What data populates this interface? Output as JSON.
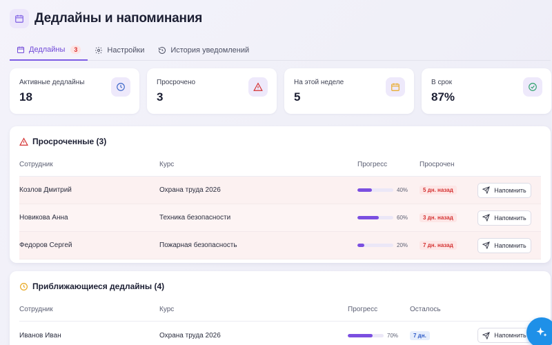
{
  "page": {
    "title": "Дедлайны и напоминания"
  },
  "tabs": [
    {
      "label": "Дедлайны",
      "badge": "3",
      "active": true
    },
    {
      "label": "Настройки",
      "active": false
    },
    {
      "label": "История уведомлений",
      "active": false
    }
  ],
  "stats": [
    {
      "label": "Активные дедлайны",
      "value": "18",
      "icon": "clock-icon"
    },
    {
      "label": "Просрочено",
      "value": "3",
      "icon": "warning-icon"
    },
    {
      "label": "На этой неделе",
      "value": "5",
      "icon": "calendar-icon"
    },
    {
      "label": "В срок",
      "value": "87%",
      "icon": "check-circle-icon"
    }
  ],
  "overdue": {
    "title": "Просроченные (3)",
    "headers": {
      "employee": "Сотрудник",
      "course": "Курс",
      "progress": "Прогресс",
      "status": "Просрочен"
    },
    "rows": [
      {
        "employee": "Козлов Дмитрий",
        "course": "Охрана труда 2026",
        "progress": 40,
        "progress_label": "40%",
        "status": "5 дн. назад",
        "action": "Напомнить"
      },
      {
        "employee": "Новикова Анна",
        "course": "Техника безопасности",
        "progress": 60,
        "progress_label": "60%",
        "status": "3 дн. назад",
        "action": "Напомнить"
      },
      {
        "employee": "Федоров Сергей",
        "course": "Пожарная безопасность",
        "progress": 20,
        "progress_label": "20%",
        "status": "7 дн. назад",
        "action": "Напомнить"
      }
    ]
  },
  "upcoming": {
    "title": "Приближающиеся дедлайны (4)",
    "headers": {
      "employee": "Сотрудник",
      "course": "Курс",
      "progress": "Прогресс",
      "status": "Осталось"
    },
    "rows": [
      {
        "employee": "Иванов Иван",
        "course": "Охрана труда 2026",
        "progress": 70,
        "progress_label": "70%",
        "status": "7 дн.",
        "action": "Напомнить"
      }
    ]
  },
  "colors": {
    "accent": "#7c5ce4",
    "danger": "#d43030",
    "warning": "#e8a820",
    "success": "#2aa06a",
    "info": "#1e90e8"
  }
}
